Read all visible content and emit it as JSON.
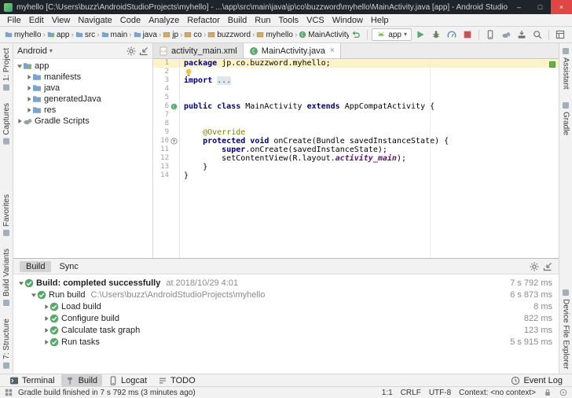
{
  "window": {
    "title": "myhello [C:\\Users\\buzz\\AndroidStudioProjects\\myhello] - ...\\app\\src\\main\\java\\jp\\co\\buzzword\\myhello\\MainActivity.java [app] - Android Studio",
    "controls": {
      "minimize": "–",
      "maximize": "□",
      "close": "×"
    }
  },
  "menu": {
    "items": [
      "File",
      "Edit",
      "View",
      "Navigate",
      "Code",
      "Analyze",
      "Refactor",
      "Build",
      "Run",
      "Tools",
      "VCS",
      "Window",
      "Help"
    ]
  },
  "breadcrumbs": {
    "separator": "›",
    "items": [
      {
        "label": "myhello",
        "icon": "folder"
      },
      {
        "label": "app",
        "icon": "module"
      },
      {
        "label": "src",
        "icon": "folder"
      },
      {
        "label": "main",
        "icon": "folder"
      },
      {
        "label": "java",
        "icon": "folder"
      },
      {
        "label": "jp",
        "icon": "package"
      },
      {
        "label": "co",
        "icon": "package"
      },
      {
        "label": "buzzword",
        "icon": "package"
      },
      {
        "label": "myhello",
        "icon": "package"
      },
      {
        "label": "MainActivity",
        "icon": "class"
      }
    ]
  },
  "run_toolbar": {
    "config_label": "app",
    "items": [
      {
        "kind": "icon",
        "name": "sync-project-button",
        "icon": "back"
      },
      {
        "kind": "sep"
      },
      {
        "kind": "config"
      },
      {
        "kind": "icon",
        "name": "run-button",
        "icon": "run"
      },
      {
        "kind": "icon",
        "name": "debug-button",
        "icon": "bug"
      },
      {
        "kind": "icon",
        "name": "profiler-button",
        "icon": "profiler"
      },
      {
        "kind": "icon",
        "name": "stop-button",
        "icon": "stop"
      },
      {
        "kind": "sep"
      },
      {
        "kind": "icon",
        "name": "avd-manager-button",
        "icon": "phone"
      },
      {
        "kind": "icon",
        "name": "gradle-sync-button",
        "icon": "gradle"
      },
      {
        "kind": "icon",
        "name": "sdk-manager-button",
        "icon": "sdk"
      },
      {
        "kind": "icon",
        "name": "search-everywhere-button",
        "icon": "search"
      },
      {
        "kind": "sep"
      },
      {
        "kind": "icon",
        "name": "project-structure-button",
        "icon": "structure"
      }
    ]
  },
  "project_panel": {
    "view_selector": "Android",
    "tree": [
      {
        "label": "app",
        "level": 0,
        "chevron": "expanded",
        "icon": "module"
      },
      {
        "label": "manifests",
        "level": 1,
        "chevron": "collapsed",
        "icon": "folder"
      },
      {
        "label": "java",
        "level": 1,
        "chevron": "collapsed",
        "icon": "folder"
      },
      {
        "label": "generatedJava",
        "level": 1,
        "chevron": "collapsed",
        "icon": "folder"
      },
      {
        "label": "res",
        "level": 1,
        "chevron": "collapsed",
        "icon": "folder"
      },
      {
        "label": "Gradle Scripts",
        "level": 0,
        "chevron": "collapsed",
        "icon": "gradle"
      }
    ]
  },
  "editor": {
    "tabs": [
      {
        "label": "activity_main.xml",
        "icon": "xml",
        "active": false,
        "closable": false
      },
      {
        "label": "MainActivity.java",
        "icon": "class",
        "active": true,
        "closable": true
      }
    ],
    "lines": [
      {
        "n": 1,
        "caret": true,
        "segs": [
          {
            "t": "package ",
            "c": "kw"
          },
          {
            "t": "jp.co.buzzword.myhello;",
            "c": "pl"
          }
        ]
      },
      {
        "n": 2,
        "bulb": true,
        "segs": []
      },
      {
        "n": 3,
        "segs": [
          {
            "t": "import ",
            "c": "kw"
          },
          {
            "t": "...",
            "c": "fold"
          }
        ]
      },
      {
        "n": 4,
        "segs": []
      },
      {
        "n": 5,
        "segs": []
      },
      {
        "n": 6,
        "gutter_icon": "class",
        "segs": [
          {
            "t": "public class ",
            "c": "kw"
          },
          {
            "t": "MainActivity ",
            "c": "pl"
          },
          {
            "t": "extends ",
            "c": "kw"
          },
          {
            "t": "AppCompatActivity {",
            "c": "pl"
          }
        ]
      },
      {
        "n": 7,
        "segs": []
      },
      {
        "n": 8,
        "segs": []
      },
      {
        "n": 9,
        "segs": [
          {
            "t": "    ",
            "c": "pl"
          },
          {
            "t": "@Override",
            "c": "ann"
          }
        ]
      },
      {
        "n": 10,
        "gutter_icon": "override",
        "segs": [
          {
            "t": "    ",
            "c": "pl"
          },
          {
            "t": "protected void ",
            "c": "kw"
          },
          {
            "t": "onCreate(Bundle savedInstanceState) {",
            "c": "pl"
          }
        ]
      },
      {
        "n": 11,
        "segs": [
          {
            "t": "        ",
            "c": "pl"
          },
          {
            "t": "super",
            "c": "kw"
          },
          {
            "t": ".onCreate(savedInstanceState);",
            "c": "pl"
          }
        ]
      },
      {
        "n": 12,
        "segs": [
          {
            "t": "        setContentView(R.layout.",
            "c": "pl"
          },
          {
            "t": "activity_main",
            "c": "field"
          },
          {
            "t": ");",
            "c": "pl"
          }
        ]
      },
      {
        "n": 13,
        "segs": [
          {
            "t": "    }",
            "c": "pl"
          }
        ]
      },
      {
        "n": 14,
        "segs": [
          {
            "t": "}",
            "c": "pl"
          }
        ]
      }
    ]
  },
  "build_panel": {
    "tabs": [
      "Build",
      "Sync"
    ],
    "active_tab": "Build",
    "rows": [
      {
        "level": 0,
        "chevron": "expanded",
        "label": "Build: completed successfully",
        "suffix": "at 2018/10/29 4:01",
        "duration": "7 s 792 ms"
      },
      {
        "level": 1,
        "chevron": "expanded",
        "label": "Run build",
        "suffix": "C:\\Users\\buzz\\AndroidStudioProjects\\myhello",
        "duration": "6 s 873 ms"
      },
      {
        "level": 2,
        "chevron": "collapsed",
        "label": "Load build",
        "suffix": "",
        "duration": "8 ms"
      },
      {
        "level": 2,
        "chevron": "collapsed",
        "label": "Configure build",
        "suffix": "",
        "duration": "822 ms"
      },
      {
        "level": 2,
        "chevron": "collapsed",
        "label": "Calculate task graph",
        "suffix": "",
        "duration": "123 ms"
      },
      {
        "level": 2,
        "chevron": "collapsed",
        "label": "Run tasks",
        "suffix": "",
        "duration": "5 s 915 ms"
      }
    ]
  },
  "tool_stripes": {
    "left_top": [
      "1: Project",
      "Captures"
    ],
    "left_bottom": [
      "Favorites",
      "Build Variants",
      "7: Structure"
    ],
    "right_top": [
      "Assistant",
      "Gradle"
    ],
    "right_bottom": [
      "Device File Explorer"
    ]
  },
  "bottom_bar": {
    "items": [
      {
        "label": "Terminal",
        "icon": "terminal",
        "active": false
      },
      {
        "label": "Build",
        "icon": "hammer",
        "active": true
      },
      {
        "label": "Logcat",
        "icon": "phone",
        "active": false
      },
      {
        "label": "TODO",
        "icon": "todo",
        "active": false
      }
    ],
    "right_items": [
      {
        "label": "Event Log",
        "icon": "clock",
        "active": false
      }
    ]
  },
  "status_bar": {
    "message": "Gradle build finished in 7 s 792 ms (3 minutes ago)",
    "caret_position": "1:1",
    "line_separator": "CRLF",
    "encoding": "UTF-8",
    "context": "Context: <no context>"
  }
}
